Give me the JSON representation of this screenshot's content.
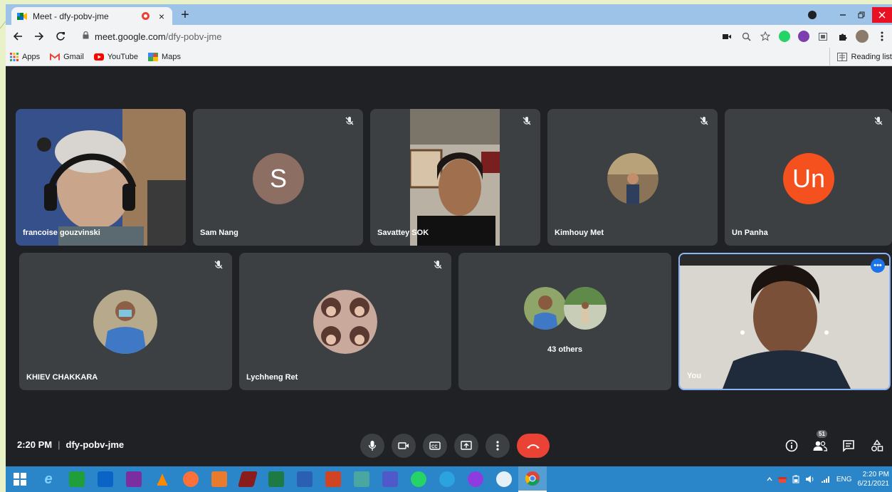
{
  "browser": {
    "tab_title": "Meet - dfy-pobv-jme",
    "tab_close": "×",
    "new_tab": "+",
    "url_domain": "meet.google.com",
    "url_path": "/dfy-pobv-jme",
    "bookmarks": [
      {
        "label": "Apps"
      },
      {
        "label": "Gmail"
      },
      {
        "label": "YouTube"
      },
      {
        "label": "Maps"
      }
    ],
    "reading_list": "Reading list"
  },
  "participants_top": [
    {
      "name": "francoise gouzvinski",
      "muted": false
    },
    {
      "name": "Sam Nang",
      "avatar_letter": "S",
      "avatar_color": "#8d6e63",
      "muted": true
    },
    {
      "name": "Savattey SOK",
      "muted": true
    },
    {
      "name": "Kimhouy Met",
      "muted": true
    },
    {
      "name": "Un Panha",
      "avatar_letter": "Un",
      "avatar_color": "#f4511e",
      "muted": true
    }
  ],
  "participants_bottom": [
    {
      "name": "KHIEV CHAKKARA",
      "muted": true
    },
    {
      "name": "Lychheng Ret",
      "muted": true
    },
    {
      "others_label": "43 others"
    },
    {
      "name": "You"
    }
  ],
  "meeting": {
    "time": "2:20 PM",
    "separator": "|",
    "code": "dfy-pobv-jme",
    "participant_count": "51",
    "self_menu": "•••"
  },
  "taskbar": {
    "language": "ENG",
    "time": "2:20 PM",
    "date": "6/21/2021"
  },
  "colors": {
    "meet_bg": "#202124",
    "tile_bg": "#3c4043",
    "end_call": "#ea4335",
    "accent": "#1a73e8",
    "taskbar": "#2a86c8"
  }
}
